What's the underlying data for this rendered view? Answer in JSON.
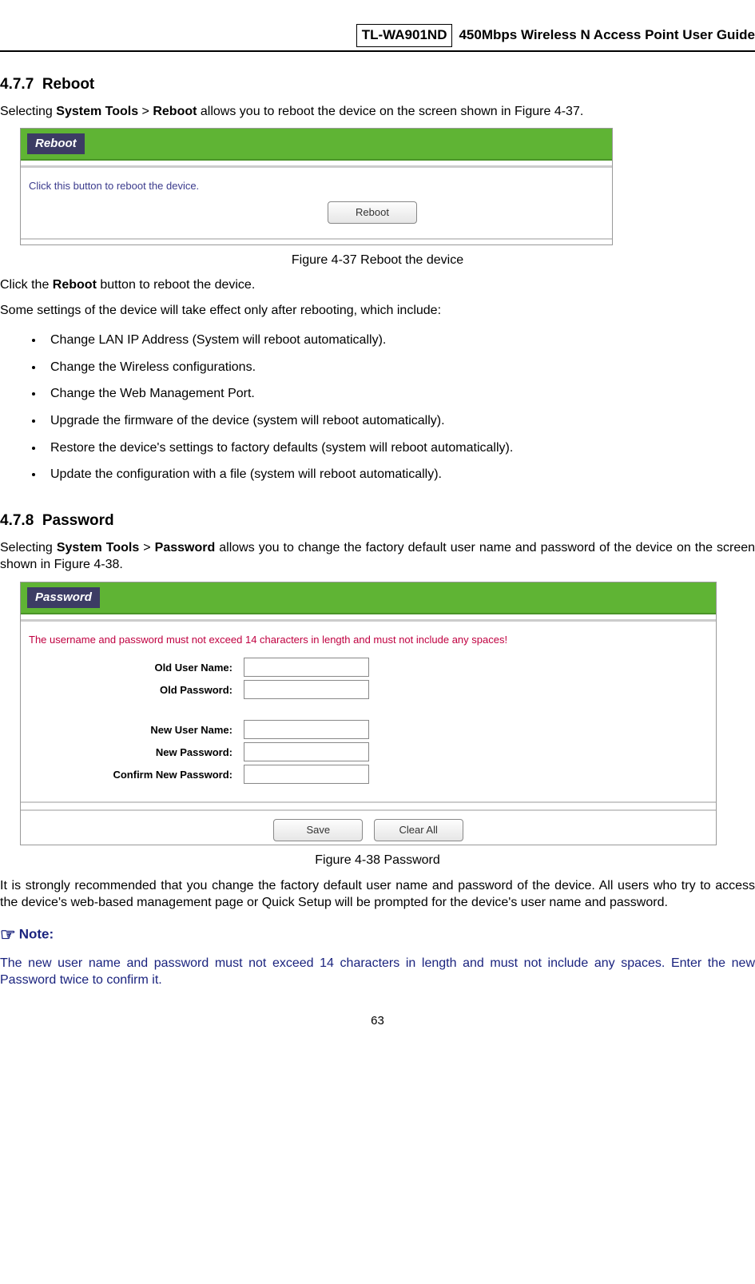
{
  "header": {
    "model": "TL-WA901ND",
    "title": "450Mbps Wireless N Access Point User Guide"
  },
  "section477": {
    "number": "4.7.7",
    "title": "Reboot",
    "intro_pre": "Selecting ",
    "intro_bold1": "System Tools",
    "intro_mid": " > ",
    "intro_bold2": "Reboot",
    "intro_post": " allows you to reboot the device on the screen shown in Figure 4-37.",
    "panel_title": "Reboot",
    "panel_hint": "Click this button to reboot the device.",
    "panel_button": "Reboot",
    "caption": "Figure 4-37 Reboot the device",
    "click_line_pre": "Click the ",
    "click_line_bold": "Reboot",
    "click_line_post": " button to reboot the device.",
    "some_settings": "Some settings of the device will take effect only after rebooting, which include:",
    "bullets": [
      "Change LAN IP Address (System will reboot automatically).",
      "Change the Wireless configurations.",
      "Change the Web Management Port.",
      "Upgrade the firmware of the device (system will reboot automatically).",
      "Restore the device's settings to factory defaults (system will reboot automatically).",
      "Update the configuration with a file (system will reboot automatically)."
    ]
  },
  "section478": {
    "number": "4.7.8",
    "title": "Password",
    "intro_pre": "Selecting ",
    "intro_bold1": "System Tools",
    "intro_mid": " > ",
    "intro_bold2": "Password",
    "intro_post": " allows you to change the factory default user name and password of the device on the screen shown in Figure 4-38.",
    "panel_title": "Password",
    "panel_warn": "The username and password must not exceed 14 characters in length and must not include any spaces!",
    "labels": {
      "old_user": "Old User Name:",
      "old_pass": "Old Password:",
      "new_user": "New User Name:",
      "new_pass": "New Password:",
      "confirm": "Confirm New Password:"
    },
    "btn_save": "Save",
    "btn_clear": "Clear All",
    "caption": "Figure 4-38 Password",
    "recommend": "It is strongly recommended that you change the factory default user name and password of the device. All users who try to access the device's web-based management page or Quick Setup will be prompted for the device's user name and password.",
    "note_label": "Note:",
    "note_body": "The new user name and password must not exceed 14 characters in length and must not include any spaces. Enter the new Password twice to confirm it."
  },
  "page_number": "63"
}
